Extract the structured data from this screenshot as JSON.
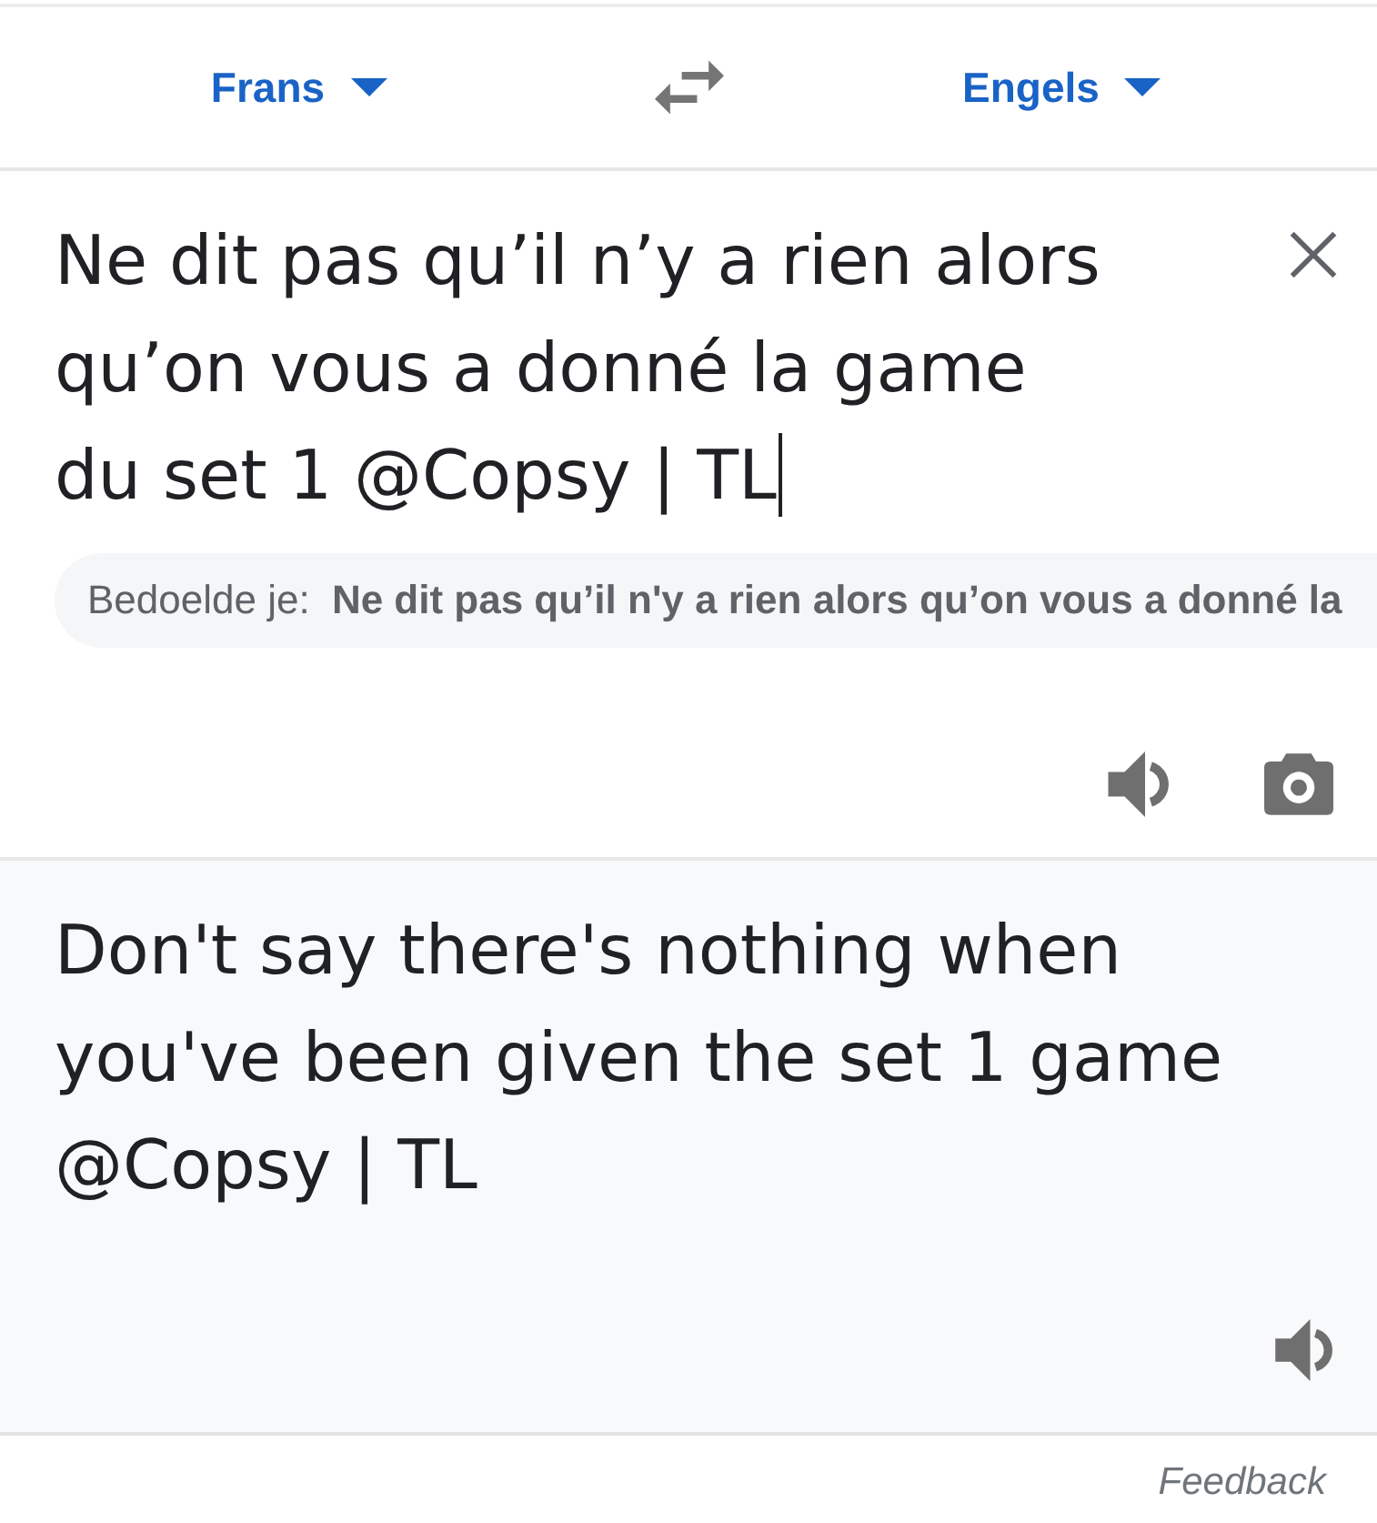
{
  "header": {
    "source_language": {
      "label": "Frans"
    },
    "target_language": {
      "label": "Engels"
    }
  },
  "source": {
    "value": "Ne dit pas qu’il n’y a rien alors qu’on vous a donné la game du set 1 @Copsy | TL",
    "focused": true,
    "suggestion": "Bedoelde je: **Ne dit pas qu’il n'y a rien alors qu’on vous a donné la**"
  },
  "translation": {
    "text": "Don't say there's nothing when you've been given the set 1 game @Copsy | TL"
  },
  "footer": {
    "link": "Feedback"
  }
}
